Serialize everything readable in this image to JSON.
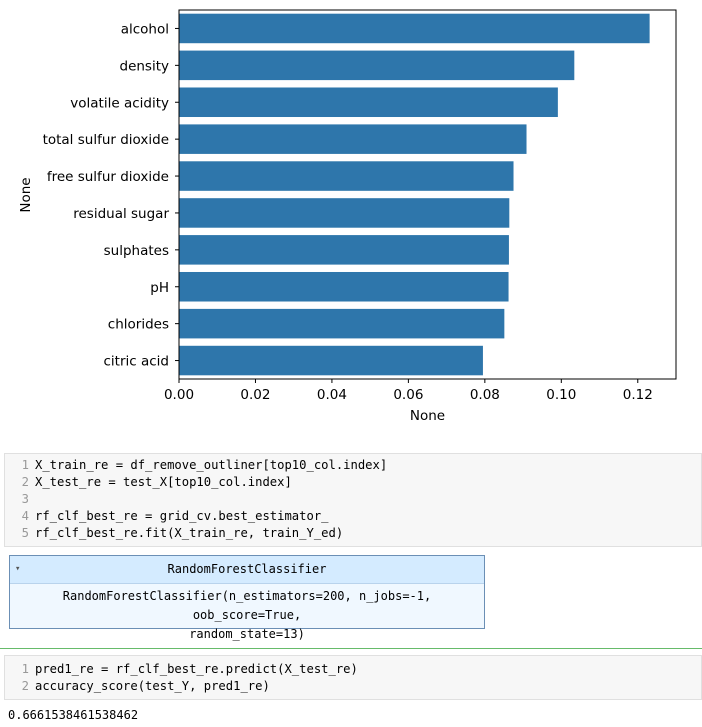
{
  "chart_data": {
    "type": "bar",
    "orientation": "horizontal",
    "categories": [
      "alcohol",
      "density",
      "volatile acidity",
      "total sulfur dioxide",
      "free sulfur dioxide",
      "residual sugar",
      "sulphates",
      "pH",
      "chlorides",
      "citric acid"
    ],
    "values": [
      0.1231,
      0.1034,
      0.0991,
      0.0909,
      0.0875,
      0.0864,
      0.0863,
      0.0862,
      0.0851,
      0.0795
    ],
    "xlabel": "None",
    "ylabel": "None",
    "xlim": [
      0,
      0.13
    ],
    "xticks": [
      0.0,
      0.02,
      0.04,
      0.06,
      0.08,
      0.1,
      0.12
    ],
    "xtick_labels": [
      "0.00",
      "0.02",
      "0.04",
      "0.06",
      "0.08",
      "0.10",
      "0.12"
    ],
    "bar_color": "#2e76ab",
    "grid": false
  },
  "cell1": {
    "lines": [
      {
        "num": "1",
        "code": "X_train_re = df_remove_outliner[top10_col.index]"
      },
      {
        "num": "2",
        "code": "X_test_re = test_X[top10_col.index]"
      },
      {
        "num": "3",
        "code": ""
      },
      {
        "num": "4",
        "code": "rf_clf_best_re = grid_cv.best_estimator_"
      },
      {
        "num": "5",
        "code": "rf_clf_best_re.fit(X_train_re, train_Y_ed)"
      }
    ]
  },
  "estimator": {
    "toggle": "▾",
    "title": "RandomForestClassifier",
    "repr_line1": "RandomForestClassifier(n_estimators=200, n_jobs=-1, oob_score=True,",
    "repr_line2": "random_state=13)"
  },
  "cell2": {
    "lines": [
      {
        "num": "1",
        "code": "pred1_re = rf_clf_best_re.predict(X_test_re)"
      },
      {
        "num": "2",
        "code": "accuracy_score(test_Y, pred1_re)"
      }
    ]
  },
  "output": {
    "value": "0.6661538461538462"
  }
}
